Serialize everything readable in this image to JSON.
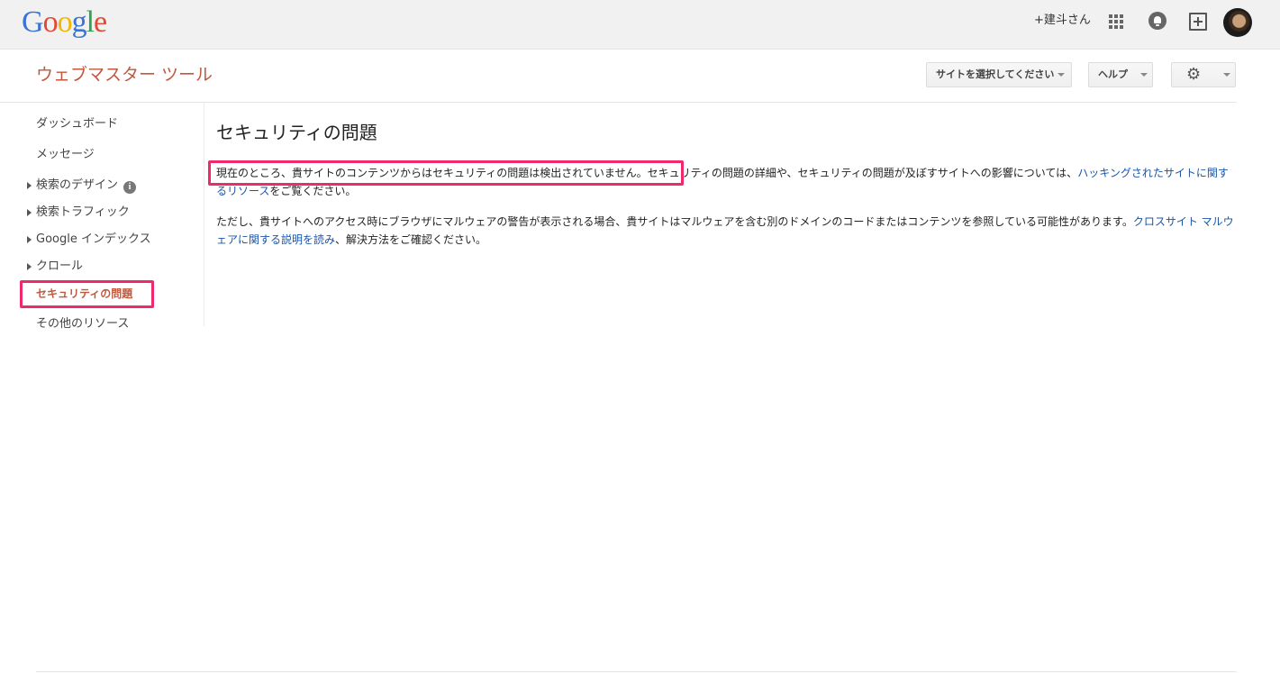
{
  "gbar": {
    "logo_letters": [
      {
        "ch": "G",
        "color": "#3b74d4"
      },
      {
        "ch": "o",
        "color": "#e04a37"
      },
      {
        "ch": "o",
        "color": "#f2b705"
      },
      {
        "ch": "g",
        "color": "#3b74d4"
      },
      {
        "ch": "l",
        "color": "#2fa34a"
      },
      {
        "ch": "e",
        "color": "#e04a37"
      }
    ],
    "user_name": "+建斗さん",
    "icons": [
      "apps-icon",
      "bell-icon",
      "plus-box-icon",
      "avatar"
    ]
  },
  "header": {
    "app_title": "ウェブマスター ツール",
    "site_select_label": "サイトを選択してください",
    "help_label": "ヘルプ",
    "settings_icon": "gear-icon"
  },
  "sidebar": {
    "items": [
      {
        "label": "ダッシュボード",
        "expandable": false
      },
      {
        "label": "メッセージ",
        "expandable": false
      },
      {
        "label": "検索のデザイン",
        "expandable": true,
        "info": "i"
      },
      {
        "label": "検索トラフィック",
        "expandable": true
      },
      {
        "label": "Google インデックス",
        "expandable": true
      },
      {
        "label": "クロール",
        "expandable": true
      },
      {
        "label": "セキュリティの問題",
        "expandable": false,
        "active": true
      },
      {
        "label": "その他のリソース",
        "expandable": false
      }
    ]
  },
  "main": {
    "title": "セキュリティの問題",
    "p1_highlight": "現在のところ、貴サイトのコンテンツからはセキュリティの問題は検出されていません。",
    "p1_text": "セキュリティの問題の詳細や、セキュリティの問題が及ぼすサイトへの影響については、",
    "p1_link": "ハッキングされたサイトに関するリソース",
    "p1_tail": "をご覧ください。",
    "p2_text": "ただし、貴サイトへのアクセス時にブラウザにマルウェアの警告が表示される場合、貴サイトはマルウェアを含む別のドメインのコードまたはコンテンツを参照している可能性があります。",
    "p2_link": "クロスサイト マルウェアに関する説明を読み",
    "p2_tail": "、解決方法をご確認ください。"
  },
  "colors": {
    "accent": "#c1583d",
    "link": "#1a55a8",
    "annotation": "#ef2a6a"
  }
}
